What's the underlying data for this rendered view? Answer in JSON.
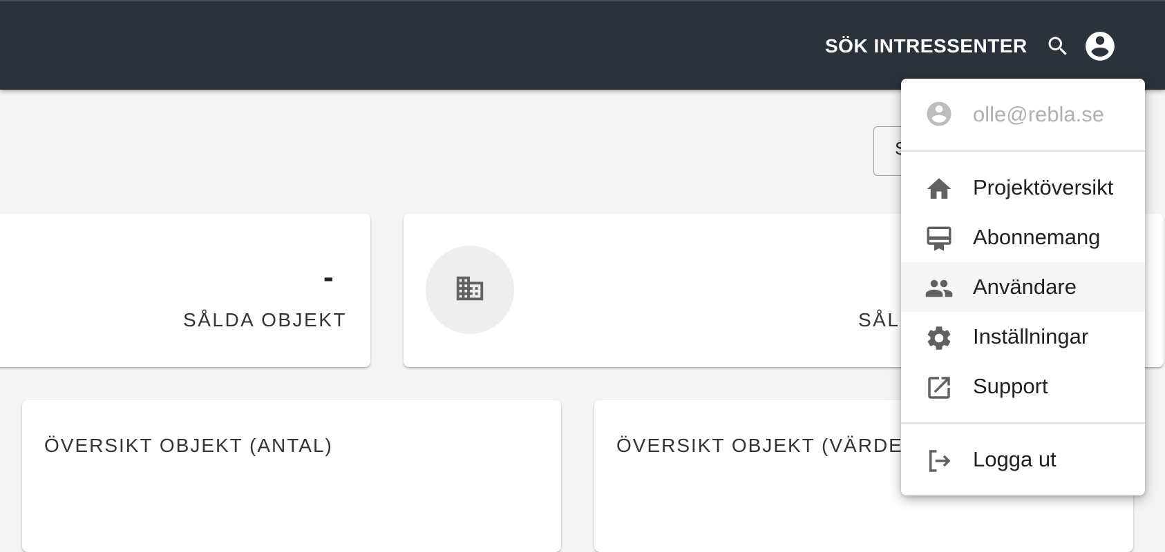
{
  "header": {
    "search_label": "SÖK INTRESSENTER",
    "search_icon": "search-icon",
    "account_icon": "account-circle-icon",
    "background": "#2b323a"
  },
  "toolbar": {
    "partial_button_text": "S"
  },
  "stats": {
    "sold_objects": {
      "value": "-",
      "caption": "SÅLDA OBJEKT"
    },
    "buildings": {
      "icon": "building-icon",
      "caption": "SÅLD"
    }
  },
  "charts": {
    "count_title": "ÖVERSIKT OBJEKT (ANTAL)",
    "value_title": "ÖVERSIKT OBJEKT (VÄRDE)"
  },
  "menu": {
    "email": "olle@rebla.se",
    "items": [
      {
        "label": "Projektöversikt",
        "icon": "home-icon"
      },
      {
        "label": "Abonnemang",
        "icon": "card-membership-icon"
      },
      {
        "label": "Användare",
        "icon": "people-icon",
        "active": true
      },
      {
        "label": "Inställningar",
        "icon": "settings-gear-icon"
      },
      {
        "label": "Support",
        "icon": "open-in-new-icon"
      }
    ],
    "logout_label": "Logga ut",
    "logout_icon": "logout-icon"
  }
}
